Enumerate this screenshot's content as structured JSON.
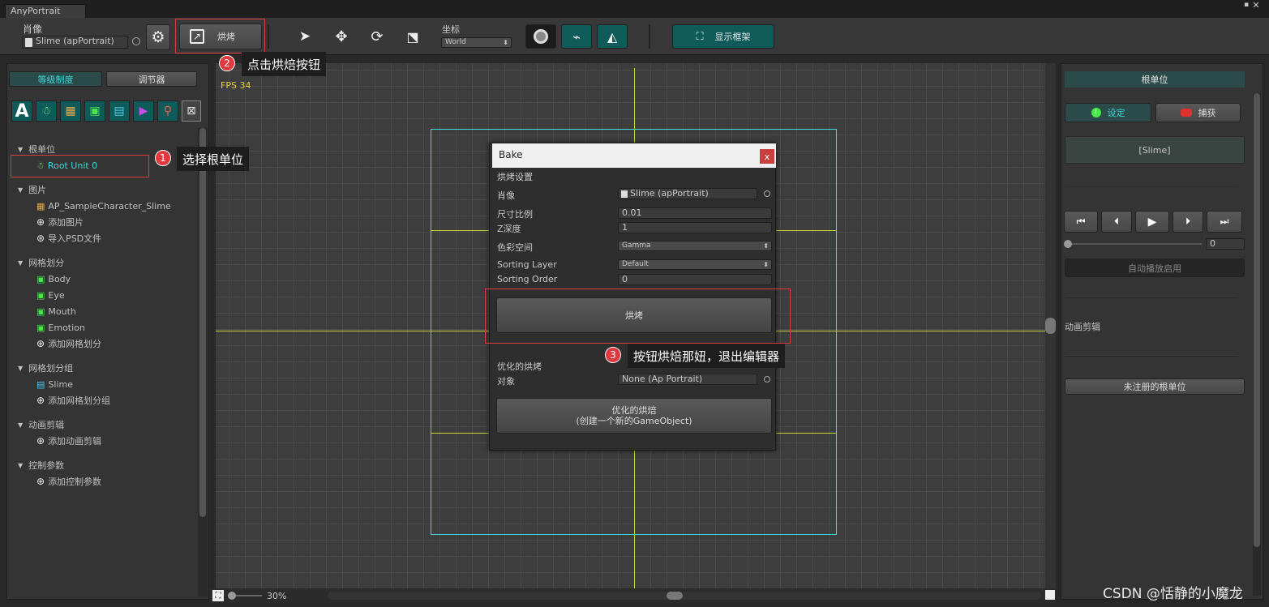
{
  "window": {
    "tab_title": "AnyPortrait"
  },
  "toolbar": {
    "portrait_label": "肖像",
    "portrait_value": "Slime (apPortrait)",
    "bake_label": "烘烤",
    "coord_label": "坐标",
    "coord_value": "World",
    "show_frame_label": "显示框架"
  },
  "left_tabs": {
    "hierarchy": "等级制度",
    "controller": "调节器"
  },
  "tree": {
    "root_header": "根单位",
    "root_item": "Root Unit 0",
    "images_header": "图片",
    "image_item": "AP_SampleCharacter_Slime",
    "add_image": "添加图片",
    "import_psd": "导入PSD文件",
    "mesh_header": "网格划分",
    "meshes": [
      "Body",
      "Eye",
      "Mouth",
      "Emotion"
    ],
    "add_mesh": "添加网格划分",
    "mesh_group_header": "网格划分组",
    "mesh_group_item": "Slime",
    "add_mesh_group": "添加网格划分组",
    "anim_header": "动画剪辑",
    "add_anim": "添加动画剪辑",
    "param_header": "控制参数",
    "add_param": "添加控制参数"
  },
  "viewport": {
    "fps": "FPS 34",
    "zoom": "30%"
  },
  "bake_dialog": {
    "title": "Bake",
    "close": "x",
    "section": "烘烤设置",
    "portrait_label": "肖像",
    "portrait_value": "Slime (apPortrait)",
    "scale_label": "尺寸比例",
    "scale_value": "0.01",
    "z_label": "Z深度",
    "z_value": "1",
    "color_label": "色彩空间",
    "color_value": "Gamma",
    "sorting_layer_label": "Sorting Layer",
    "sorting_layer_value": "Default",
    "sorting_order_label": "Sorting Order",
    "sorting_order_value": "0",
    "bake_button": "烘烤",
    "optimized_label": "优化的烘烤",
    "target_label": "对象",
    "target_value": "None (Ap Portrait)",
    "opt_button_line1": "优化的烘焙",
    "opt_button_line2": "(创建一个新的GameObject)"
  },
  "right_panel": {
    "header": "根单位",
    "set_button": "设定",
    "capture_button": "捕获",
    "slime_label": "[Slime]",
    "timeline_value": "0",
    "autoplay_button": "自动播放启用",
    "anim_clip_label": "动画剪辑",
    "unregistered_button": "未注册的根单位"
  },
  "callouts": {
    "c1_num": "1",
    "c1_text": "选择根单位",
    "c2_num": "2",
    "c2_text": "点击烘焙按钮",
    "c3_num": "3",
    "c3_text": "按钮烘焙那妞，退出编辑器"
  },
  "watermark": "CSDN @恬静的小魔龙",
  "colors": {
    "accent_cyan": "#3fd8d8",
    "guide_yellow": "#c8d23c",
    "callout_red": "#e0393e"
  }
}
